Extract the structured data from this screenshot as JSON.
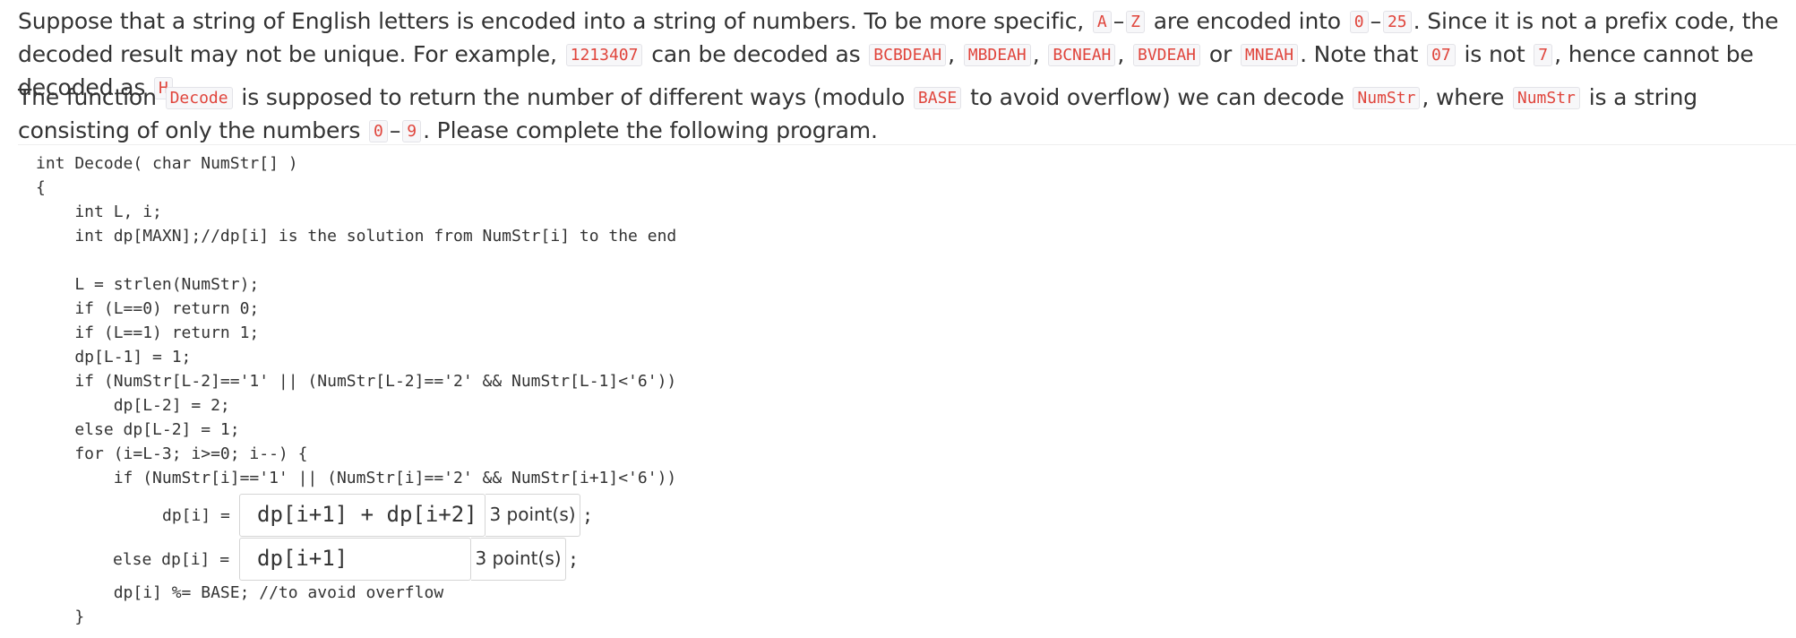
{
  "paragraph1": {
    "s1": "Suppose that a string of English letters is encoded into a string of numbers.  To be more specific,",
    "c1": "A",
    "s2": "–",
    "c2": "Z",
    "s3": "are encoded into",
    "c3": "0",
    "s4": "–",
    "c4": "25",
    "s5": ".  Since it is not a prefix code, the decoded result may not be unique. For example,",
    "c5": "1213407",
    "s6": "can be decoded as",
    "c6": "BCBDEAH",
    "s7": ",",
    "c7": "MBDEAH",
    "s8": ",",
    "c8": "BCNEAH",
    "s9": ",",
    "c9": "BVDEAH",
    "s10": "or",
    "c10": "MNEAH",
    "s11": ".  Note that",
    "c11": "07",
    "s12": "is not",
    "c12": "7",
    "s13": ", hence cannot be decoded as",
    "c13": "H",
    "s14": "."
  },
  "paragraph2": {
    "s1": "The function",
    "c1": "Decode",
    "s2": "is supposed to return the number of different ways (modulo",
    "c2": "BASE",
    "s3": "to avoid overflow) we can decode",
    "c3": "NumStr",
    "s4": ", where",
    "c4": "NumStr",
    "s5": "is a string consisting of only the num­bers",
    "c5": "0",
    "s6": "–",
    "c6": "9",
    "s7": ". Please complete the following program."
  },
  "code_lines": [
    "int Decode( char NumStr[] )",
    "{",
    "    int L, i;",
    "    int dp[MAXN];//dp[i] is the solution from NumStr[i] to the end",
    "",
    "    L = strlen(NumStr);",
    "    if (L==0) return 0;",
    "    if (L==1) return 1;",
    "    dp[L-1] = 1;",
    "    if (NumStr[L-2]=='1' || (NumStr[L-2]=='2' && NumStr[L-1]<'6'))",
    "        dp[L-2] = 2;",
    "    else dp[L-2] = 1;",
    "    for (i=L-3; i>=0; i--) {",
    "        if (NumStr[i]=='1' || (NumStr[i]=='2' && NumStr[i+1]<'6'))"
  ],
  "blank1": {
    "prefix": "dp[i] =",
    "value": "dp[i+1] + dp[i+2]",
    "points": "3 point(s)",
    "suffix": ";"
  },
  "blank2": {
    "prefix": "else dp[i] =",
    "value": "dp[i+1]",
    "points": "3 point(s)",
    "suffix": ";"
  },
  "code_after": [
    "        dp[i] %= BASE; //to avoid overflow",
    "    }"
  ]
}
